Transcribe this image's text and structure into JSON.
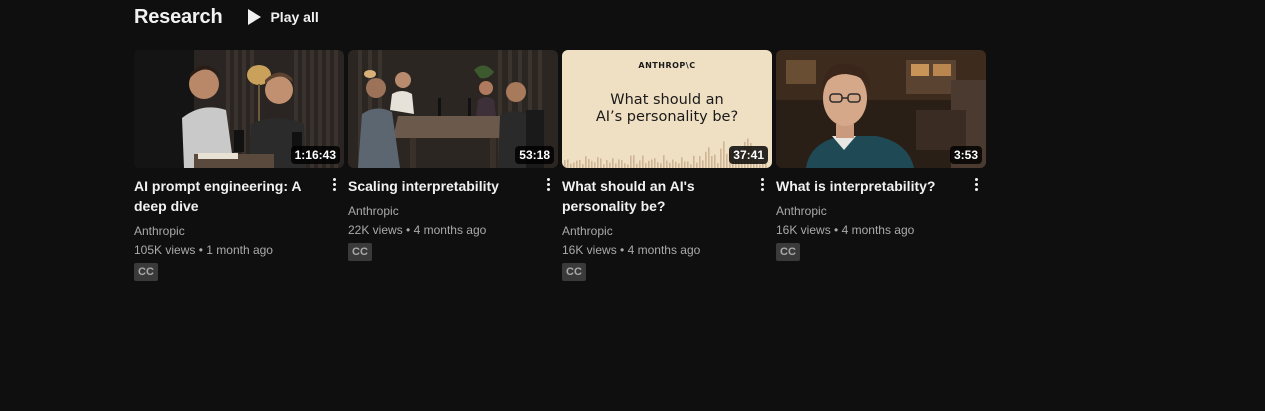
{
  "shelf": {
    "title": "Research",
    "play_all_label": "Play all",
    "play_icon": "play-icon"
  },
  "videos": [
    {
      "title": "AI prompt engineering: A deep dive",
      "channel": "Anthropic",
      "views": "105K views",
      "age": "1 month ago",
      "separator": "•",
      "duration": "1:16:43",
      "badge": "CC"
    },
    {
      "title": "Scaling interpretability",
      "channel": "Anthropic",
      "views": "22K views",
      "age": "4 months ago",
      "separator": "•",
      "duration": "53:18",
      "badge": "CC"
    },
    {
      "title": "What should an AI's personality be?",
      "channel": "Anthropic",
      "views": "16K views",
      "age": "4 months ago",
      "separator": "•",
      "duration": "37:41",
      "badge": "CC",
      "thumbnail_brand": "ANTHROP\\C",
      "thumbnail_text_line1": "What should an",
      "thumbnail_text_line2": "AI’s personality be?"
    },
    {
      "title": "What is interpretability?",
      "channel": "Anthropic",
      "views": "16K views",
      "age": "4 months ago",
      "separator": "•",
      "duration": "3:53",
      "badge": "CC"
    }
  ],
  "colors": {
    "background": "#0f0f0f",
    "text_primary": "#f1f1f1",
    "text_secondary": "#aaaaaa",
    "badge_bg": "#3a3a3a",
    "thumbnail_beige": "#efdfc3"
  }
}
